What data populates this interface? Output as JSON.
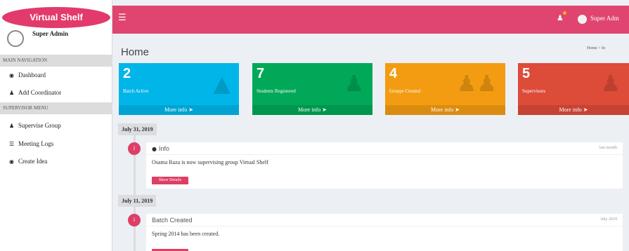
{
  "sidebar": {
    "brand": "Virtual Shelf",
    "user_name": "Super Admin",
    "sections": [
      {
        "header": "MAIN NAVIGATION",
        "items": [
          {
            "label": "Dashboard",
            "icon": "dashboard-icon"
          },
          {
            "label": "Add Coordinator",
            "icon": "users-icon"
          }
        ]
      },
      {
        "header": "SUPERVISOR MENU",
        "items": [
          {
            "label": "Supervise Group",
            "icon": "users-icon"
          },
          {
            "label": "Meeting Logs",
            "icon": "list-icon"
          },
          {
            "label": "Create Idea",
            "icon": "lightbulb-icon"
          }
        ]
      }
    ]
  },
  "header": {
    "menu_icon": "hamburger-icon",
    "notification_icon": "bell-icon",
    "user_name": "Super Adm"
  },
  "content": {
    "title": "Home",
    "breadcrumb": "Home  >  In"
  },
  "stats": [
    {
      "value": "2",
      "label": "Batch Active",
      "footer": "More info",
      "icon": "graduation-cap-icon",
      "color": "#00b6e9"
    },
    {
      "value": "7",
      "label": "Students Registered",
      "footer": "More info",
      "icon": "user-plus-icon",
      "color": "#00a857"
    },
    {
      "value": "4",
      "label": "Groups Created",
      "footer": "More info",
      "icon": "users-icon",
      "color": "#f39c12"
    },
    {
      "value": "5",
      "label": "Supervisors",
      "footer": "More info",
      "icon": "user-icon",
      "color": "#dd4b39"
    }
  ],
  "timeline": [
    {
      "date": "July 31, 2019",
      "title": "Info",
      "time": "last month",
      "body": "Osama Raza is now supervising group Virtual Shelf",
      "button": "Show Details"
    },
    {
      "date": "July 11, 2019",
      "title": "Batch Created",
      "time": "July 2019",
      "body": "Spring 2014 has been created.",
      "button": ""
    }
  ]
}
